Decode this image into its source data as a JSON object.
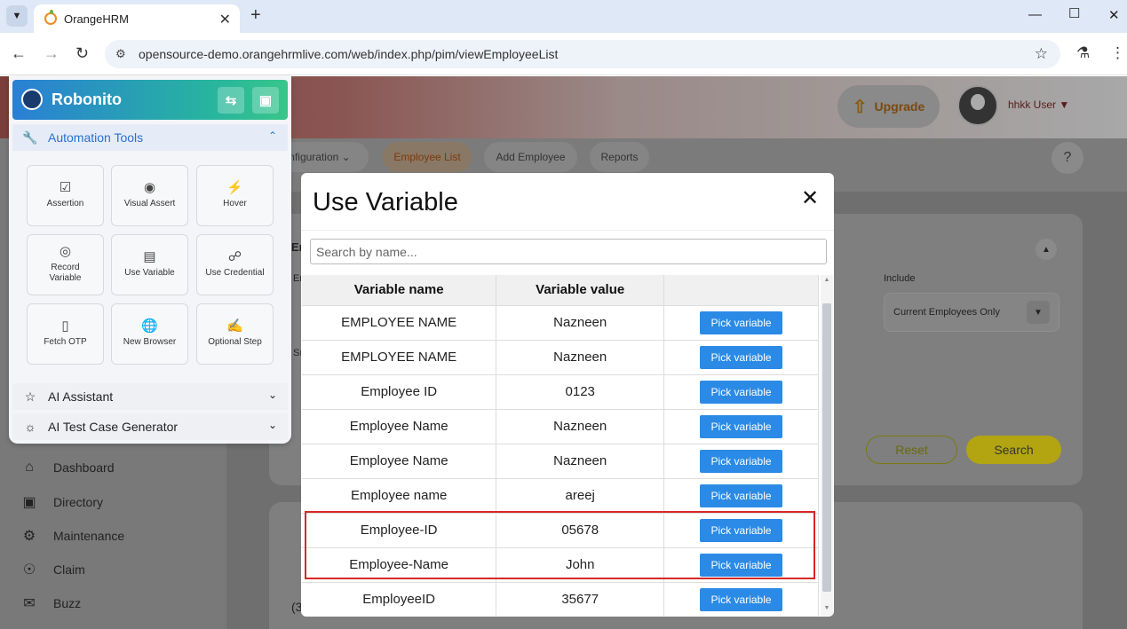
{
  "browser": {
    "tab_title": "OrangeHRM",
    "url": "opensource-demo.orangehrmlive.com/web/index.php/pim/viewEmployeeList"
  },
  "app": {
    "upgrade_label": "Upgrade",
    "user_name": "hhkk User",
    "nav_tabs": [
      "nfiguration",
      "Employee List",
      "Add Employee",
      "Reports"
    ],
    "include_label": "Include",
    "include_value": "Current Employees Only",
    "reset_label": "Reset",
    "search_label": "Search",
    "sidebar": [
      "Dashboard",
      "Directory",
      "Maintenance",
      "Claim",
      "Buzz"
    ],
    "partial_labels": {
      "e1": "Er",
      "e2": "Er",
      "s": "Sı",
      "count": "(3"
    }
  },
  "robonito": {
    "title": "Robonito",
    "tools_section": "Automation Tools",
    "tools": [
      {
        "label": "Assertion",
        "icon": "assertion-icon"
      },
      {
        "label": "Visual Assert",
        "icon": "eye-icon"
      },
      {
        "label": "Hover",
        "icon": "hover-icon"
      },
      {
        "label": "Record Variable",
        "icon": "record-icon"
      },
      {
        "label": "Use Variable",
        "icon": "document-icon"
      },
      {
        "label": "Use Credential",
        "icon": "lock-icon"
      },
      {
        "label": "Fetch OTP",
        "icon": "phone-icon"
      },
      {
        "label": "New Browser",
        "icon": "globe-icon"
      },
      {
        "label": "Optional Step",
        "icon": "clipboard-icon"
      }
    ],
    "ai_assistant": "AI Assistant",
    "ai_generator": "AI Test Case Generator"
  },
  "modal": {
    "title": "Use Variable",
    "search_placeholder": "Search by name...",
    "columns": [
      "Variable name",
      "Variable value",
      ""
    ],
    "pick_label": "Pick variable",
    "rows": [
      {
        "name": "EMPLOYEE NAME",
        "value": "Nazneen"
      },
      {
        "name": "EMPLOYEE NAME",
        "value": "Nazneen"
      },
      {
        "name": "Employee ID",
        "value": "0123"
      },
      {
        "name": "Employee Name",
        "value": "Nazneen"
      },
      {
        "name": "Employee Name",
        "value": "Nazneen"
      },
      {
        "name": "Employee name",
        "value": "areej"
      },
      {
        "name": "Employee-ID",
        "value": "05678"
      },
      {
        "name": "Employee-Name",
        "value": "John"
      },
      {
        "name": "EmployeeID",
        "value": "35677"
      }
    ]
  },
  "colors": {
    "accent": "#2b8ae6",
    "highlight": "#d62828",
    "robonito_header": "#2a7fd5"
  }
}
